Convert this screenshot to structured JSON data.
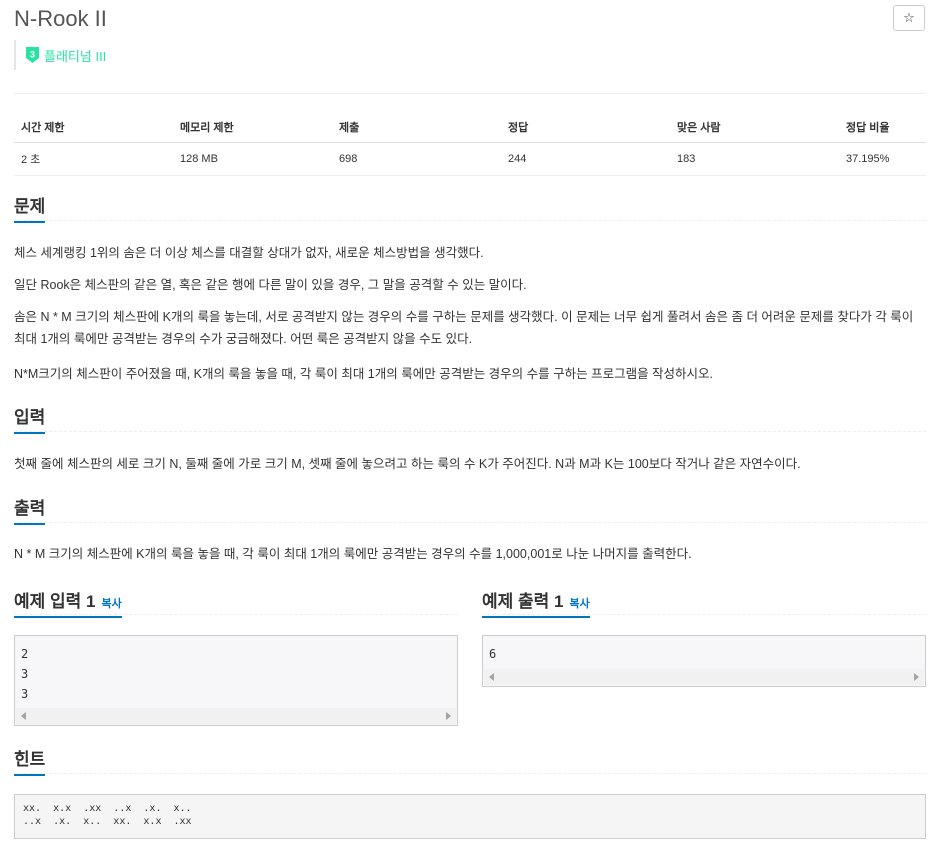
{
  "problem": {
    "title": "N-Rook II",
    "star_icon": "☆",
    "tier_number": "3",
    "tier_label": "플래티넘 III",
    "tier_color": "#27e2a4"
  },
  "info_table": {
    "headers": [
      "시간 제한",
      "메모리 제한",
      "제출",
      "정답",
      "맞은 사람",
      "정답 비율"
    ],
    "values": [
      "2 초",
      "128 MB",
      "698",
      "244",
      "183",
      "37.195%"
    ]
  },
  "sections": {
    "problem_title": "문제",
    "problem_paragraphs": [
      "체스 세계랭킹 1위의 솜은 더 이상 체스를 대결할 상대가 없자, 새로운 체스방법을 생각했다.",
      "일단 Rook은 체스판의 같은 열, 혹은 같은 행에 다른 말이 있을 경우, 그 말을 공격할 수 있는 말이다.",
      "솜은 N * M 크기의 체스판에 K개의 룩을 놓는데, 서로 공격받지 않는 경우의 수를 구하는 문제를 생각했다. 이 문제는 너무 쉽게 풀려서 솜은 좀 더 어려운 문제를 찾다가 각 룩이 최대 1개의 룩에만 공격받는 경우의 수가 궁금해졌다. 어떤 룩은 공격받지 않을 수도 있다.",
      "N*M크기의 체스판이 주어졌을 때, K개의 룩을 놓을 때, 각 룩이 최대 1개의 룩에만 공격받는 경우의 수를 구하는 프로그램을 작성하시오."
    ],
    "input_title": "입력",
    "input_text": "첫째 줄에 체스판의 세로 크기 N, 둘째 줄에 가로 크기 M, 셋째 줄에 놓으려고 하는 룩의 수 K가 주어진다. N과 M과 K는 100보다 작거나 같은 자연수이다.",
    "output_title": "출력",
    "output_text": "N * M 크기의 체스판에 K개의 룩을 놓을 때, 각 룩이 최대 1개의 룩에만 공격받는 경우의 수를 1,000,001로 나눈 나머지를 출력한다.",
    "hint_title": "힌트",
    "hint_text": "xx.  x.x  .xx  ..x  .x.  x..\n..x  .x.  x..  xx.  x.x  .xx"
  },
  "samples": {
    "input_title": "예제 입력 1",
    "output_title": "예제 출력 1",
    "copy_label": "복사",
    "input_lines": [
      "2",
      "3",
      "3"
    ],
    "output_lines": [
      "6"
    ]
  },
  "colors": {
    "link": "#0076c0",
    "tier": "#27e2a4"
  }
}
